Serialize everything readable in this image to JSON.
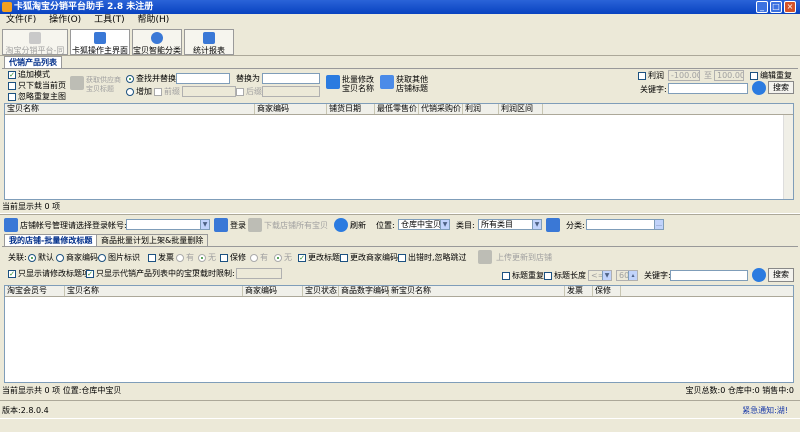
{
  "window": {
    "title": "卡狐淘宝分销平台助手 2.8 未注册",
    "min": "_",
    "max": "□",
    "close": "×"
  },
  "menu": [
    "文件(F)",
    "操作(O)",
    "工具(T)",
    "帮助(H)"
  ],
  "nav_tabs": [
    {
      "label": "淘宝分销平台-同步",
      "disabled": true
    },
    {
      "label": "卡狐操作主界面",
      "active": true
    },
    {
      "label": "宝贝智能分类"
    },
    {
      "label": "统计报表"
    }
  ],
  "top": {
    "tab": "代销产品列表",
    "chk_append": "追加模式",
    "chk_current_page": "只下载当前页",
    "chk_ignore_dup": "忽略重复主图",
    "btn_fetch_supplier": "获取供应商\n宝贝标题",
    "radio_find_replace": "查找并替换",
    "radio_add": "增加",
    "label_replace_to": "替换为",
    "chk_prefix": "前缀",
    "chk_suffix": "后缀",
    "btn_batch_modify": "批量修改\n宝贝名称",
    "btn_fetch_other": "获取其他\n店铺标题",
    "chk_profit": "利润",
    "profit_from": "-100.00",
    "profit_to_label": "至",
    "profit_to": "100.00",
    "chk_edit_dup": "编辑重复",
    "keyword_label": "关键字:",
    "search_btn": "搜索",
    "columns": [
      "宝贝名称",
      "商家编码",
      "铺货日期",
      "最低零售价",
      "代销采购价",
      "利润",
      "利润区间"
    ],
    "status": "当前显示共 0 项"
  },
  "store": {
    "manage_label": "店铺帐号管理",
    "select_label": "请选择登录帐号:",
    "login_btn": "登录",
    "download_btn": "下载店铺所有宝贝",
    "refresh_btn": "刷新",
    "location_label": "位置:",
    "location_value": "仓库中宝贝",
    "category_label": "类目:",
    "category_value": "所有类目",
    "class_label": "分类:"
  },
  "bottom": {
    "tab_active": "我的店铺-批量修改标题",
    "tab_other": "商品批量计划上架&批量删除",
    "assoc_label": "关联:",
    "radio_default": "默认",
    "radio_merchant_code": "商家编码",
    "radio_image_tag": "图片标识",
    "chk_shipping": "发票",
    "yes1": "有",
    "no1": "无",
    "chk_warranty": "保修",
    "yes2": "有",
    "no2": "无",
    "chk_change_title": "更改标题",
    "chk_change_code": "更改商家编码",
    "chk_skip_sold": "出错时,忽略跳过",
    "btn_upload": "上传更新到店铺",
    "chk_show_modifiable": "只显示请修改标题项",
    "chk_show_in_list": "只显示代销产品列表中的宝贝",
    "download_limit_label": "下载时限制:",
    "chk_title_dup": "标题重复",
    "chk_title_len": "标题长度",
    "len_op": "<=",
    "len_val": "60",
    "keyword_label": "关键字:",
    "search_btn": "搜索",
    "columns": [
      "淘宝会员号",
      "宝贝名称",
      "商家编码",
      "宝贝状态",
      "商品数字编码",
      "新宝贝名称",
      "发票",
      "保修"
    ],
    "status_left": "当前显示共 0 项  位置:仓库中宝贝",
    "status_right": "宝贝总数:0 仓库中:0 销售中:0"
  },
  "footer": {
    "version": "版本:2.8.0.4",
    "notice": "紧急通知:湖!"
  },
  "colors": {
    "title_blue": "#0a46c4",
    "tab_text": "#002e8a",
    "notice": "#1a3aa8"
  }
}
